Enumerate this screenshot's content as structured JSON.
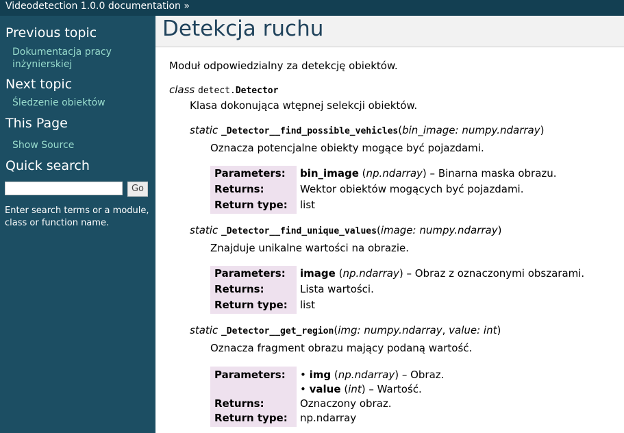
{
  "topbar": {
    "title": "Videodetection 1.0.0 documentation",
    "separator": "»"
  },
  "sidebar": {
    "previous_heading": "Previous topic",
    "previous_link_line1": "Dokumentacja pracy",
    "previous_link_line2": "inżynierskiej",
    "next_heading": "Next topic",
    "next_link": "Śledzenie obiektów",
    "this_page_heading": "This Page",
    "show_source": "Show Source",
    "search_heading": "Quick search",
    "search_value": "",
    "go_button": "Go",
    "hint": "Enter search terms or a module, class or function name."
  },
  "page": {
    "title": "Detekcja ruchu",
    "intro": "Moduł odpowiedzialny za detekcję obiektów.",
    "class_keyword": "class",
    "class_module": "detect.",
    "class_name": "Detector",
    "class_desc": "Klasa dokonująca wtępnej selekcji obiektów."
  },
  "methods": [
    {
      "keyword": "static",
      "name": "_Detector__find_possible_vehicles",
      "params": "bin_image: numpy.ndarray",
      "desc": "Oznacza potencjalne obiekty mogące być pojazdami.",
      "param_name": "bin_image",
      "param_type": "np.ndarray",
      "param_desc": " – Binarna maska obrazu.",
      "returns": "Wektor obiektów mogących być pojazdami.",
      "return_type": "list"
    },
    {
      "keyword": "static",
      "name": "_Detector__find_unique_values",
      "params": "image: numpy.ndarray",
      "desc": "Znajduje unikalne wartości na obrazie.",
      "param_name": "image",
      "param_type": "np.ndarray",
      "param_desc": " – Obraz z oznaczonymi obszarami.",
      "returns": "Lista wartości.",
      "return_type": "list"
    },
    {
      "keyword": "static",
      "name": "_Detector__get_region",
      "params_a": "img: numpy.ndarray",
      "params_sep": ", ",
      "params_b": "value: int",
      "desc": "Oznacza fragment obrazu mający podaną wartość.",
      "p1_name": "img",
      "p1_type": "np.ndarray",
      "p1_desc": " – Obraz.",
      "p2_name": "value",
      "p2_type": "int",
      "p2_desc": " – Wartość.",
      "returns": "Oznaczony obraz.",
      "return_type": "np.ndarray"
    }
  ],
  "labels": {
    "parameters": "Parameters:",
    "returns": "Returns:",
    "return_type": "Return type:",
    "open_paren": "(",
    "close_paren": ")",
    "bullet": "•"
  },
  "colors": {
    "topbar": "#133f52",
    "sidebar": "#1c4e63",
    "field_bg": "#eee1ee",
    "link": "#98dbcc",
    "title": "#20435c"
  }
}
